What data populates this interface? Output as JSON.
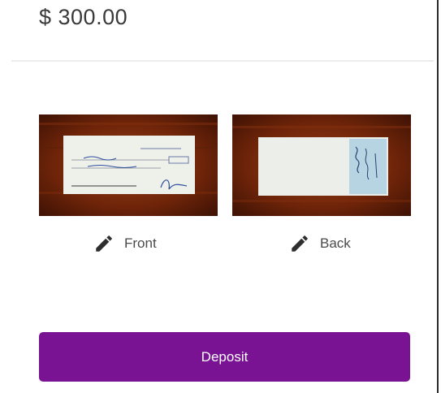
{
  "amount": {
    "text": "$ 300.00"
  },
  "images": {
    "front": {
      "label": "Front",
      "icon": "pencil-icon"
    },
    "back": {
      "label": "Back",
      "icon": "pencil-icon"
    }
  },
  "actions": {
    "deposit_label": "Deposit"
  },
  "colors": {
    "accent": "#7a1294",
    "divider": "#ececec",
    "text": "#4a4a4a"
  }
}
